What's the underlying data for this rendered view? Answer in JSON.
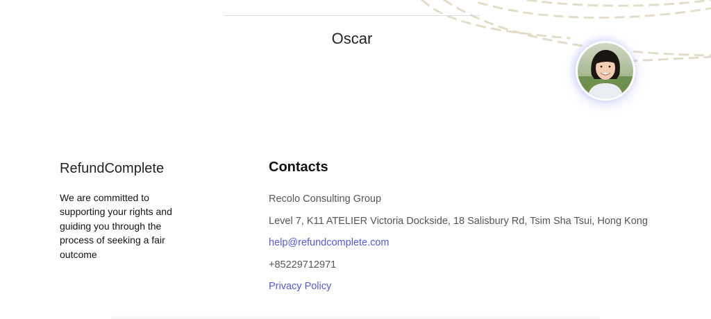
{
  "testimonial": {
    "name": "Oscar"
  },
  "footer": {
    "brand": {
      "name": "RefundComplete",
      "tagline": "We are committed to supporting your rights and guiding you through the process of seeking a fair outcome"
    },
    "contacts": {
      "heading": "Contacts",
      "company": "Recolo Consulting Group",
      "address": "Level 7, K11 ATELIER Victoria Dockside, 18 Salisbury Rd, Tsim Sha Tsui, Hong Kong",
      "email": "help@refundcomplete.com",
      "phone": "+85229712971",
      "privacy_label": "Privacy Policy"
    }
  },
  "colors": {
    "link": "#5457e0",
    "dashed_arc": "#e2dcc8",
    "avatar_glow": "#aab4ff"
  }
}
